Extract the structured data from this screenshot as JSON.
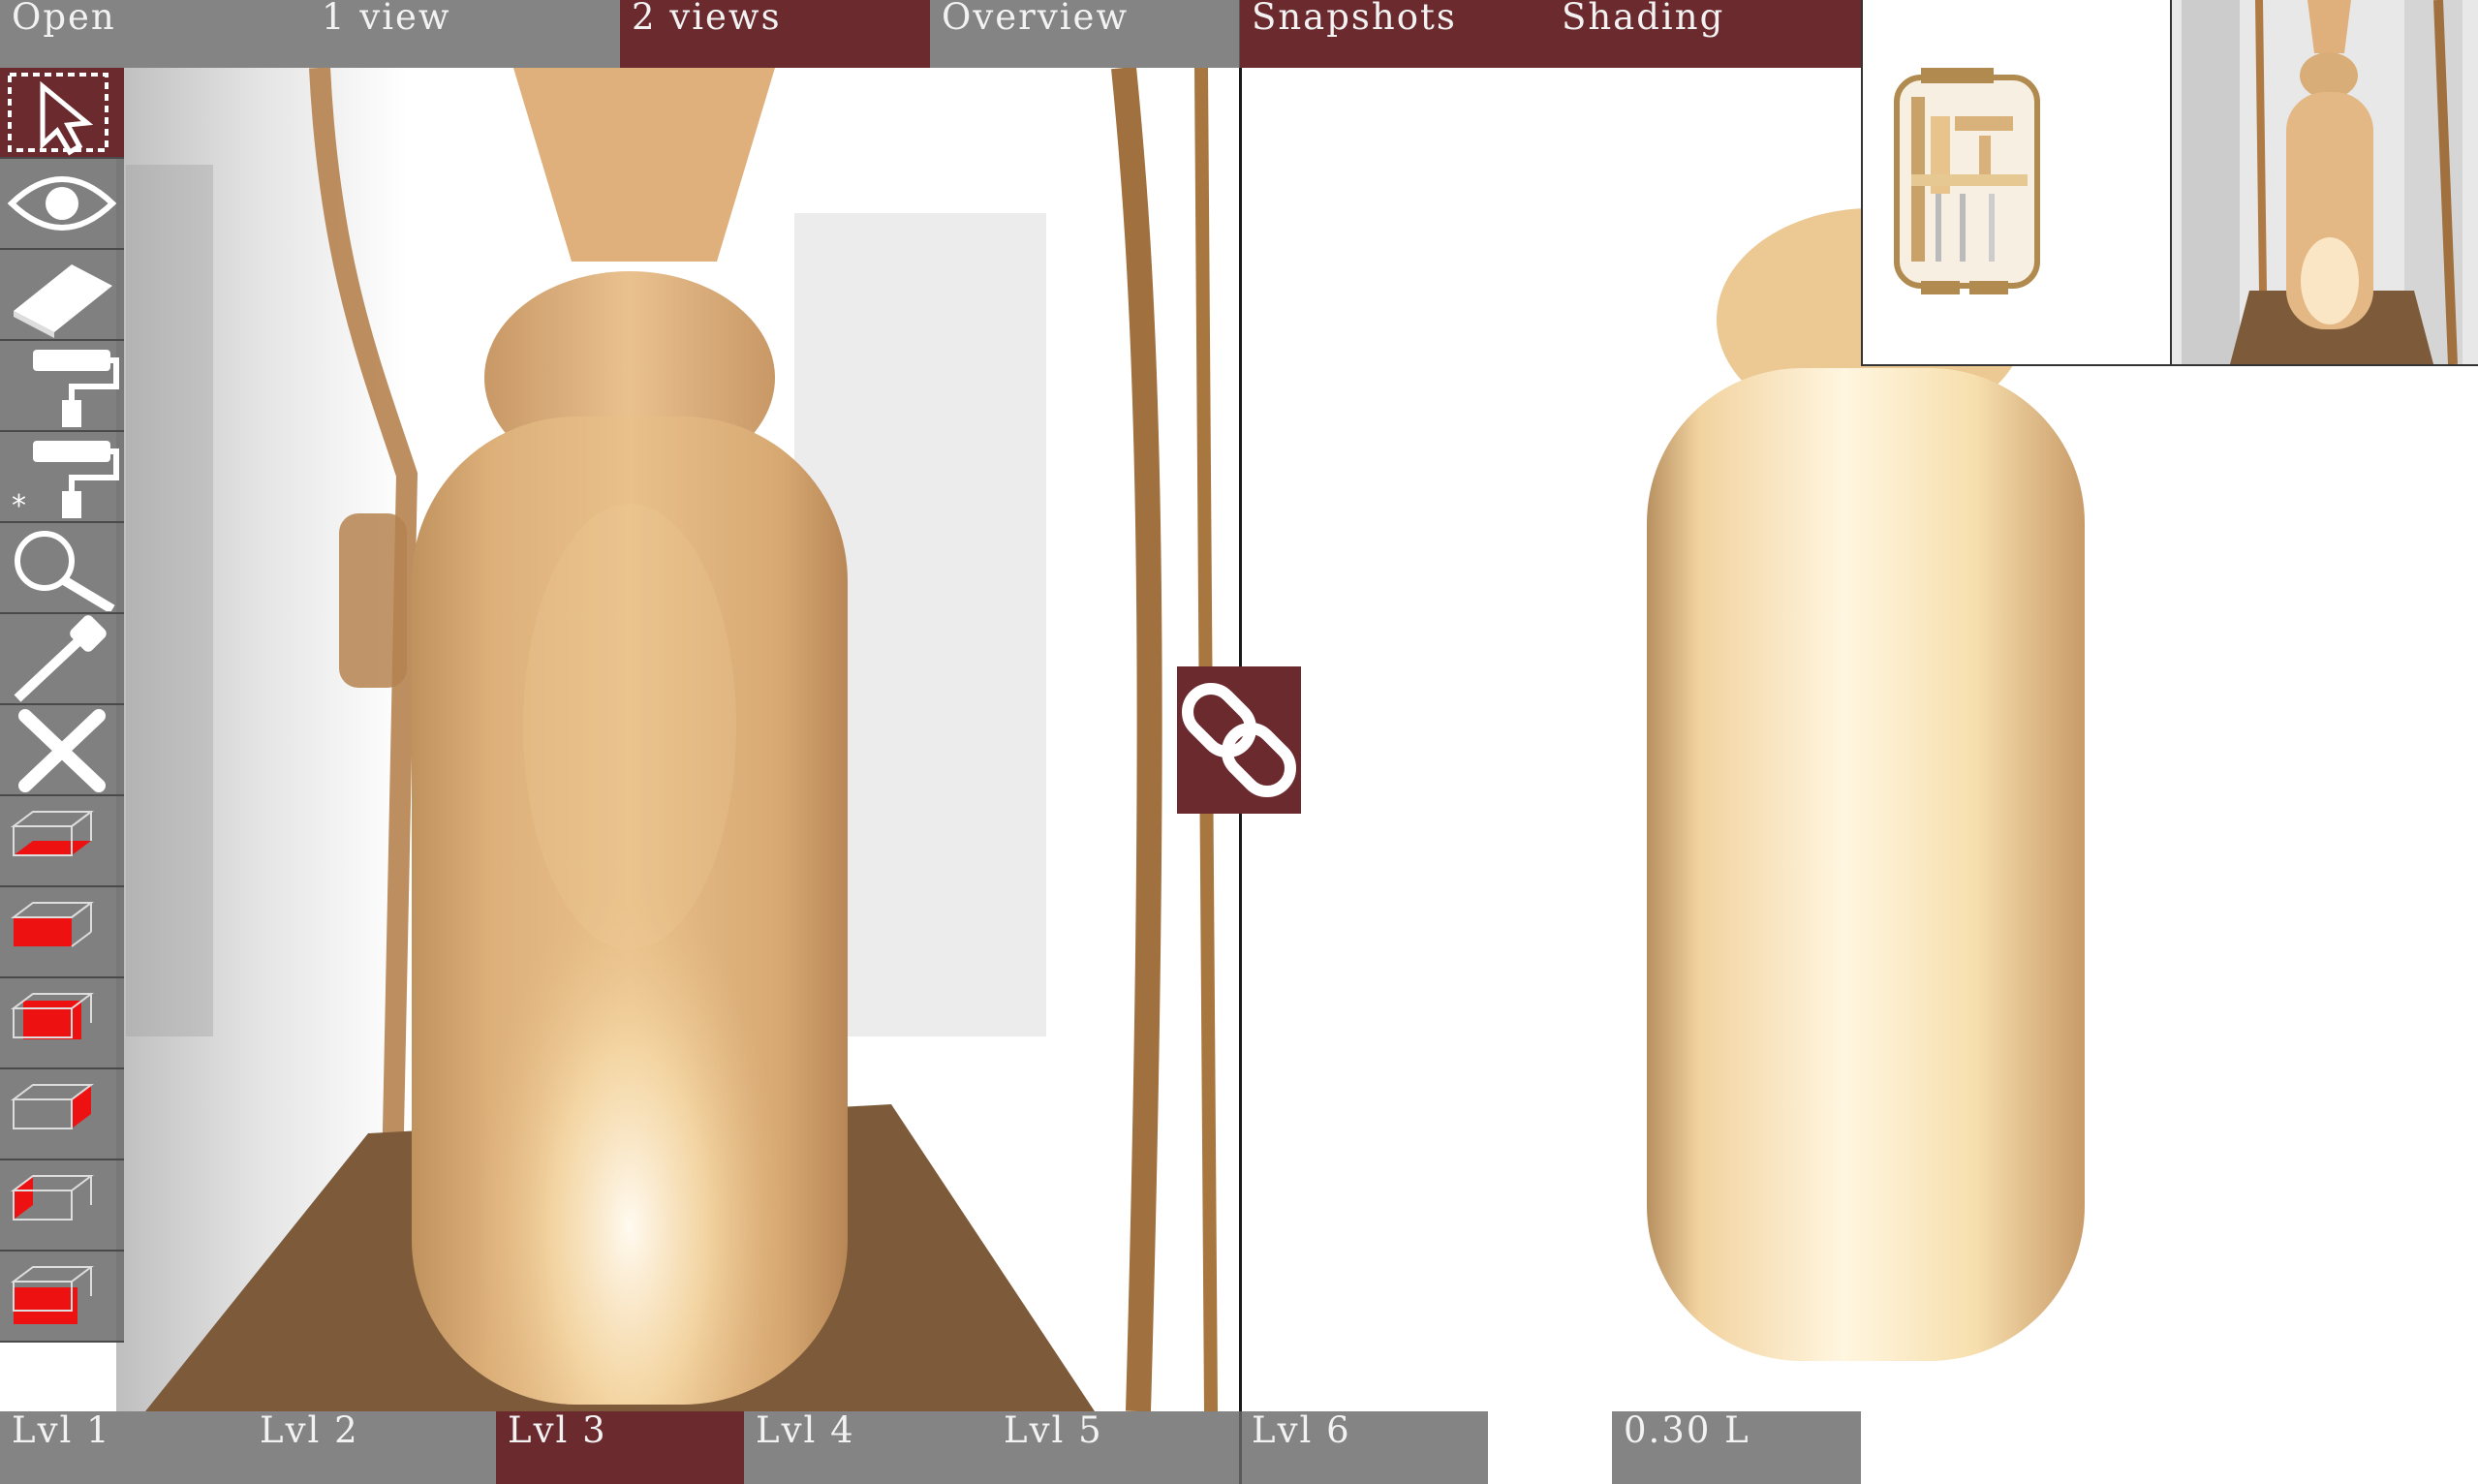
{
  "menu": {
    "items": [
      {
        "label": "Open"
      },
      {
        "label": "1 view"
      },
      {
        "label": "2 views"
      },
      {
        "label": "Overview"
      },
      {
        "label": "Snapshots"
      },
      {
        "label": "Shading"
      }
    ],
    "active": "2 views"
  },
  "toolbar": {
    "tools": [
      {
        "icon": "select-arrow-icon",
        "state": "active"
      },
      {
        "icon": "eye-icon"
      },
      {
        "icon": "eraser-icon"
      },
      {
        "icon": "paint-roller-icon"
      },
      {
        "icon": "paint-roller-star-icon"
      },
      {
        "icon": "magnifier-icon"
      },
      {
        "icon": "eyedropper-icon"
      },
      {
        "icon": "close-icon"
      },
      {
        "icon": "cube-view-bottom-icon"
      },
      {
        "icon": "cube-view-front-icon"
      },
      {
        "icon": "cube-view-top-icon"
      },
      {
        "icon": "cube-view-right-icon"
      },
      {
        "icon": "cube-view-left-icon"
      },
      {
        "icon": "cube-view-back-icon"
      }
    ]
  },
  "link": {
    "icon": "chain-link-icon"
  },
  "levels": {
    "items": [
      {
        "label": "Lvl 1"
      },
      {
        "label": "Lvl 2"
      },
      {
        "label": "Lvl 3"
      },
      {
        "label": "Lvl 4"
      },
      {
        "label": "Lvl 5"
      },
      {
        "label": "Lvl 6"
      }
    ],
    "active": "Lvl 3"
  },
  "volume": {
    "label": "0.30 L"
  },
  "colors": {
    "menu_active": "#6b2a2e",
    "menu_inactive": "#696969",
    "object_tan": "#e8bf88",
    "object_highlight": "#fff3d8",
    "marker_red": "#ee1111"
  }
}
